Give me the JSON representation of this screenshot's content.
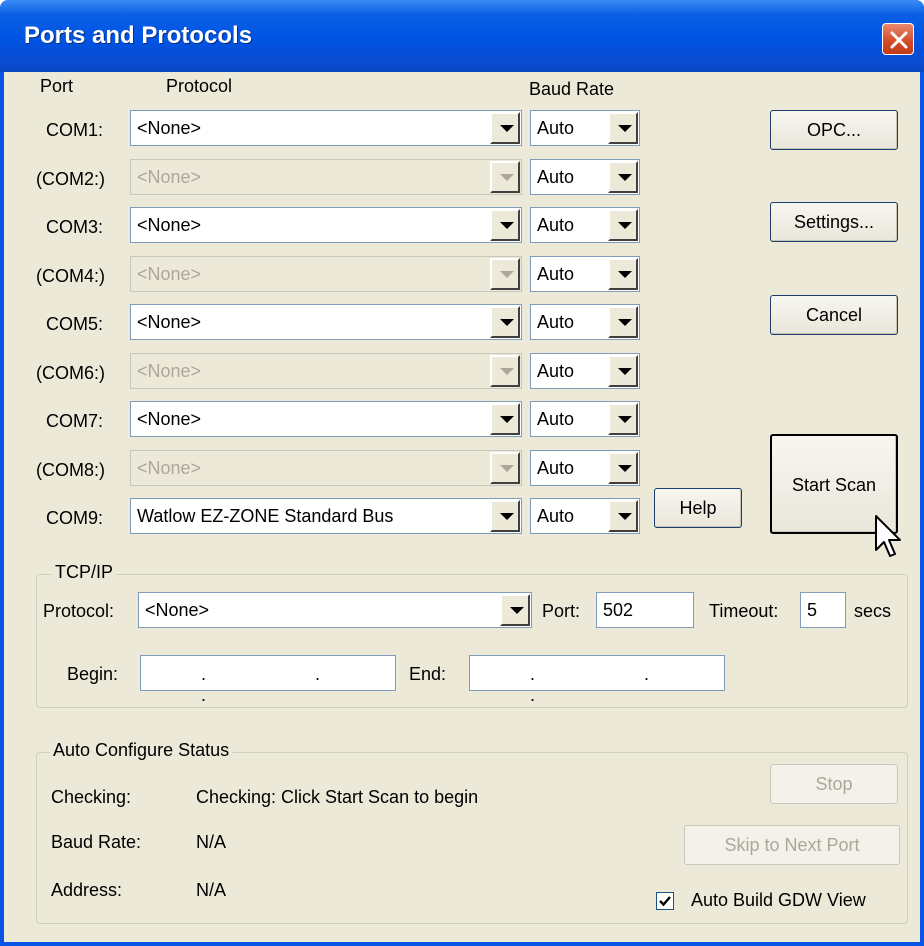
{
  "window": {
    "title": "Ports and Protocols"
  },
  "headers": {
    "port": "Port",
    "protocol": "Protocol",
    "baud_rate": "Baud Rate"
  },
  "ports": [
    {
      "name": "COM1:",
      "protocol": "<None>",
      "baud": "Auto",
      "enabled": true
    },
    {
      "name": "(COM2:)",
      "protocol": "<None>",
      "baud": "Auto",
      "enabled": false
    },
    {
      "name": "COM3:",
      "protocol": "<None>",
      "baud": "Auto",
      "enabled": true
    },
    {
      "name": "(COM4:)",
      "protocol": "<None>",
      "baud": "Auto",
      "enabled": false
    },
    {
      "name": "COM5:",
      "protocol": "<None>",
      "baud": "Auto",
      "enabled": true
    },
    {
      "name": "(COM6:)",
      "protocol": "<None>",
      "baud": "Auto",
      "enabled": false
    },
    {
      "name": "COM7:",
      "protocol": "<None>",
      "baud": "Auto",
      "enabled": true
    },
    {
      "name": "(COM8:)",
      "protocol": "<None>",
      "baud": "Auto",
      "enabled": false
    },
    {
      "name": "COM9:",
      "protocol": "Watlow EZ-ZONE Standard Bus",
      "baud": "Auto",
      "enabled": true
    }
  ],
  "buttons": {
    "opc": "OPC...",
    "settings": "Settings...",
    "cancel": "Cancel",
    "start_scan": "Start Scan",
    "help": "Help"
  },
  "tcpip": {
    "title": "TCP/IP",
    "protocol_label": "Protocol:",
    "protocol_value": "<None>",
    "port_label": "Port:",
    "port_value": "502",
    "timeout_label": "Timeout:",
    "timeout_value": "5",
    "timeout_units": "secs",
    "begin_label": "Begin:",
    "end_label": "End:",
    "ip_dots": ". . ."
  },
  "status": {
    "title": "Auto Configure Status",
    "checking_label": "Checking:",
    "checking_value": "Checking: Click Start Scan to begin",
    "baud_label": "Baud Rate:",
    "baud_value": "N/A",
    "address_label": "Address:",
    "address_value": "N/A",
    "stop": "Stop",
    "skip": "Skip to Next Port",
    "auto_build_label": "Auto Build GDW View",
    "auto_build_checked": true
  },
  "icons": {
    "close": "close-icon",
    "checkmark": "checkmark-icon",
    "cursor": "mouse-cursor-icon"
  }
}
